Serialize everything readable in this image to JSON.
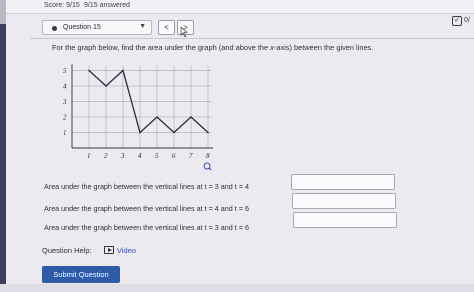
{
  "header": {
    "score_label": "Score: 9/15",
    "answered_label": "9/15 answered",
    "question_selector": "Question 15",
    "prev_glyph": "<",
    "next_glyph": ">",
    "corner_text": "0/"
  },
  "question": {
    "prompt_before": "For the graph below, find the area under the graph (and above the ",
    "prompt_var": "x",
    "prompt_after": "-axis) between the given lines."
  },
  "graph": {
    "y_ticks": [
      "1",
      "2",
      "3",
      "4",
      "5"
    ],
    "x_ticks": [
      "1",
      "2",
      "3",
      "4",
      "5",
      "6",
      "7",
      "8"
    ],
    "points": [
      [
        1,
        5
      ],
      [
        2,
        4
      ],
      [
        3,
        5
      ],
      [
        4,
        1
      ],
      [
        5,
        2
      ],
      [
        6,
        1
      ],
      [
        7,
        2
      ],
      [
        8,
        1
      ]
    ],
    "line_color": "#2b2b3a"
  },
  "rows": [
    {
      "label": "Area under the graph between the vertical lines at t = 3 and t = 4",
      "value": ""
    },
    {
      "label": "Area under the graph between the vertical lines at t = 4 and t = 6",
      "value": ""
    },
    {
      "label": "Area under the graph between the vertical lines at t = 3 and t = 6",
      "value": ""
    }
  ],
  "footer": {
    "help_label": "Question Help:",
    "video_label": "Video",
    "submit_label": "Submit Question"
  },
  "colors": {
    "submit": "#2e5aa7",
    "link": "#3a4fb5"
  }
}
